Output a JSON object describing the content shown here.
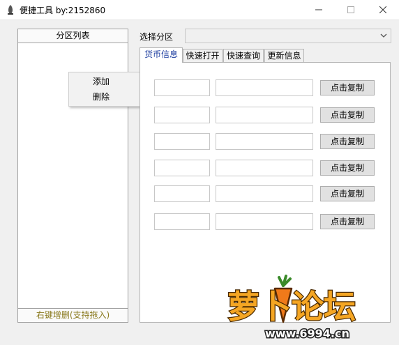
{
  "window": {
    "title": "便捷工具  by:2152860"
  },
  "left_panel": {
    "header": "分区列表",
    "footer": "右键增删(支持拖入)"
  },
  "context_menu": {
    "items": [
      "添加",
      "删除"
    ]
  },
  "selector": {
    "label": "选择分区",
    "value": ""
  },
  "tabs": [
    {
      "label": "货币信息",
      "active": true
    },
    {
      "label": "快速打开",
      "active": false
    },
    {
      "label": "快速查询",
      "active": false
    },
    {
      "label": "更新信息",
      "active": false
    }
  ],
  "rows": [
    {
      "button": "点击复制"
    },
    {
      "button": "点击复制"
    },
    {
      "button": "点击复制"
    },
    {
      "button": "点击复制"
    },
    {
      "button": "点击复制"
    },
    {
      "button": "点击复制"
    }
  ],
  "watermark": {
    "text": "萝卜论坛",
    "url": "www.6994.cn"
  },
  "colors": {
    "active_tab_text": "#1f3fa0",
    "footer_text": "#8a7a1e",
    "watermark_orange": "#f5a623"
  }
}
